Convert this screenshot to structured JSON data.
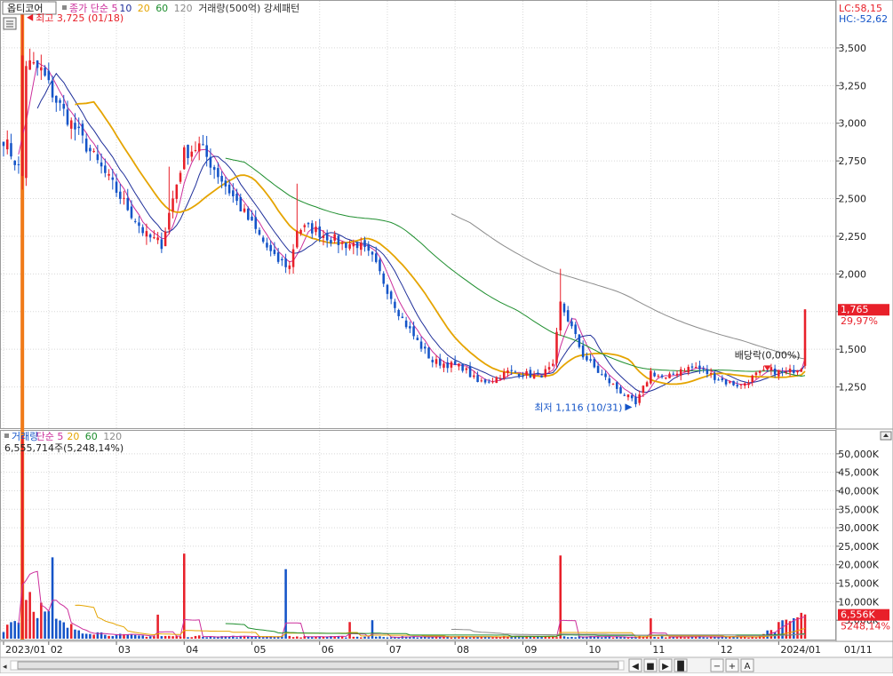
{
  "colors": {
    "up": "#e8202a",
    "down": "#1454c8",
    "ma5": "#cc2f9c",
    "ma10": "#1f2f9a",
    "ma20": "#e5a400",
    "ma60": "#1e8e2e",
    "ma120": "#8c8c8c",
    "grid": "#d8d8d8",
    "priceTag": "#e8202a",
    "orangeBar": "#f07a18"
  },
  "header": {
    "stock_name": "옵티코어",
    "legend": [
      {
        "label": "종가 단순 5",
        "color": "#cc2f9c"
      },
      {
        "label": "10",
        "color": "#1f2f9a"
      },
      {
        "label": "20",
        "color": "#e5a400"
      },
      {
        "label": "60",
        "color": "#1e8e2e"
      },
      {
        "label": "120",
        "color": "#8c8c8c"
      },
      {
        "label": "거래량(500억) 강세패턴",
        "color": "#333333"
      }
    ],
    "lc": "LC:58,15",
    "hc": "HC:-52,62"
  },
  "annotations": {
    "high": "최고 3,725 (01/18)",
    "low": "최저 1,116 (10/31)",
    "dividend": "배당락(0,00%)",
    "current_price": "1,765",
    "current_change": "29,97%",
    "volume_current": "6,556K",
    "volume_change": "5248,14%"
  },
  "volume_header": {
    "legend": [
      {
        "label": "거래량",
        "color": "#1454c8"
      },
      {
        "label": "단순 5",
        "color": "#cc2f9c"
      },
      {
        "label": "20",
        "color": "#e5a400"
      },
      {
        "label": "60",
        "color": "#1e8e2e"
      },
      {
        "label": "120",
        "color": "#8c8c8c"
      }
    ],
    "info": "6,555,714주(5,248,14%)"
  },
  "nav": {
    "buttons": [
      "◀",
      "■",
      "▶",
      "▐▌",
      "−",
      "+",
      "A"
    ]
  },
  "chart_data": [
    {
      "type": "candlestick",
      "title": "옵티코어",
      "ylim": [
        1000,
        3700
      ],
      "yticks": [
        1250,
        1500,
        1750,
        2000,
        2250,
        2500,
        2750,
        3000,
        3250,
        3500
      ],
      "ytick_labels": [
        "1,250",
        "1,500",
        "1,750",
        "2,000",
        "2,250",
        "2,500",
        "2,750",
        "3,000",
        "3,250",
        "3,500"
      ],
      "x_labels": [
        "2023/01",
        "02",
        "03",
        "04",
        "05",
        "06",
        "07",
        "08",
        "09",
        "10",
        "11",
        "12",
        "2024/01",
        "01/11"
      ],
      "close_anchors": [
        [
          0,
          2900
        ],
        [
          5,
          2650
        ],
        [
          6,
          3400
        ],
        [
          10,
          3350
        ],
        [
          14,
          3150
        ],
        [
          18,
          3000
        ],
        [
          22,
          2850
        ],
        [
          26,
          2700
        ],
        [
          30,
          2550
        ],
        [
          34,
          2400
        ],
        [
          38,
          2250
        ],
        [
          42,
          2200
        ],
        [
          44,
          2400
        ],
        [
          48,
          2800
        ],
        [
          52,
          2850
        ],
        [
          56,
          2700
        ],
        [
          60,
          2550
        ],
        [
          64,
          2400
        ],
        [
          68,
          2250
        ],
        [
          72,
          2100
        ],
        [
          76,
          2050
        ],
        [
          78,
          2300
        ],
        [
          82,
          2300
        ],
        [
          86,
          2250
        ],
        [
          90,
          2200
        ],
        [
          94,
          2200
        ],
        [
          98,
          2100
        ],
        [
          102,
          1900
        ],
        [
          106,
          1700
        ],
        [
          110,
          1550
        ],
        [
          114,
          1420
        ],
        [
          118,
          1400
        ],
        [
          122,
          1380
        ],
        [
          126,
          1280
        ],
        [
          130,
          1300
        ],
        [
          134,
          1350
        ],
        [
          138,
          1340
        ],
        [
          142,
          1320
        ],
        [
          146,
          1380
        ],
        [
          148,
          1800
        ],
        [
          150,
          1700
        ],
        [
          154,
          1460
        ],
        [
          158,
          1350
        ],
        [
          162,
          1260
        ],
        [
          166,
          1180
        ],
        [
          168,
          1130
        ],
        [
          170,
          1240
        ],
        [
          172,
          1350
        ],
        [
          176,
          1300
        ],
        [
          180,
          1370
        ],
        [
          184,
          1380
        ],
        [
          188,
          1330
        ],
        [
          192,
          1280
        ],
        [
          196,
          1260
        ],
        [
          200,
          1330
        ],
        [
          204,
          1360
        ],
        [
          208,
          1340
        ],
        [
          212,
          1390
        ],
        [
          213,
          1765
        ]
      ],
      "series": [
        {
          "name": "종가 단순 5",
          "window": 5
        },
        {
          "name": "10",
          "window": 10
        },
        {
          "name": "20",
          "window": 20
        },
        {
          "name": "60",
          "window": 60
        },
        {
          "name": "120",
          "window": 120
        }
      ],
      "markers": {
        "high": {
          "x": 5,
          "value": 3725
        },
        "low": {
          "x": 168,
          "value": 1116
        },
        "dividend": {
          "x": 203,
          "value": 1440
        }
      },
      "last_close": 1765
    },
    {
      "type": "bar",
      "title": "거래량",
      "ylim": [
        0,
        55000
      ],
      "yticks": [
        5000,
        10000,
        15000,
        20000,
        25000,
        30000,
        35000,
        40000,
        45000,
        50000
      ],
      "ytick_labels": [
        "5,000K",
        "10,000K",
        "15,000K",
        "20,000K",
        "25,000K",
        "30,000K",
        "35,000K",
        "40,000K",
        "45,000K",
        "50,000K"
      ],
      "base_anchors": [
        [
          0,
          3000
        ],
        [
          4,
          6000
        ],
        [
          5,
          55000
        ],
        [
          6,
          14000
        ],
        [
          9,
          9000
        ],
        [
          12,
          6000
        ],
        [
          16,
          3500
        ],
        [
          22,
          2000
        ],
        [
          30,
          1000
        ],
        [
          40,
          700
        ],
        [
          60,
          600
        ],
        [
          100,
          500
        ],
        [
          140,
          550
        ],
        [
          200,
          500
        ],
        [
          213,
          6556
        ]
      ],
      "spikes": [
        {
          "x": 5,
          "value": 55000
        },
        {
          "x": 13,
          "value": 22000
        },
        {
          "x": 41,
          "value": 6500
        },
        {
          "x": 48,
          "value": 23000
        },
        {
          "x": 75,
          "value": 18800
        },
        {
          "x": 92,
          "value": 4500
        },
        {
          "x": 98,
          "value": 5000
        },
        {
          "x": 148,
          "value": 22500
        },
        {
          "x": 172,
          "value": 5500
        },
        {
          "x": 213,
          "value": 6556
        }
      ],
      "series": [
        {
          "name": "단순 5",
          "window": 5
        },
        {
          "name": "20",
          "window": 20
        },
        {
          "name": "60",
          "window": 60
        },
        {
          "name": "120",
          "window": 120
        }
      ]
    }
  ]
}
